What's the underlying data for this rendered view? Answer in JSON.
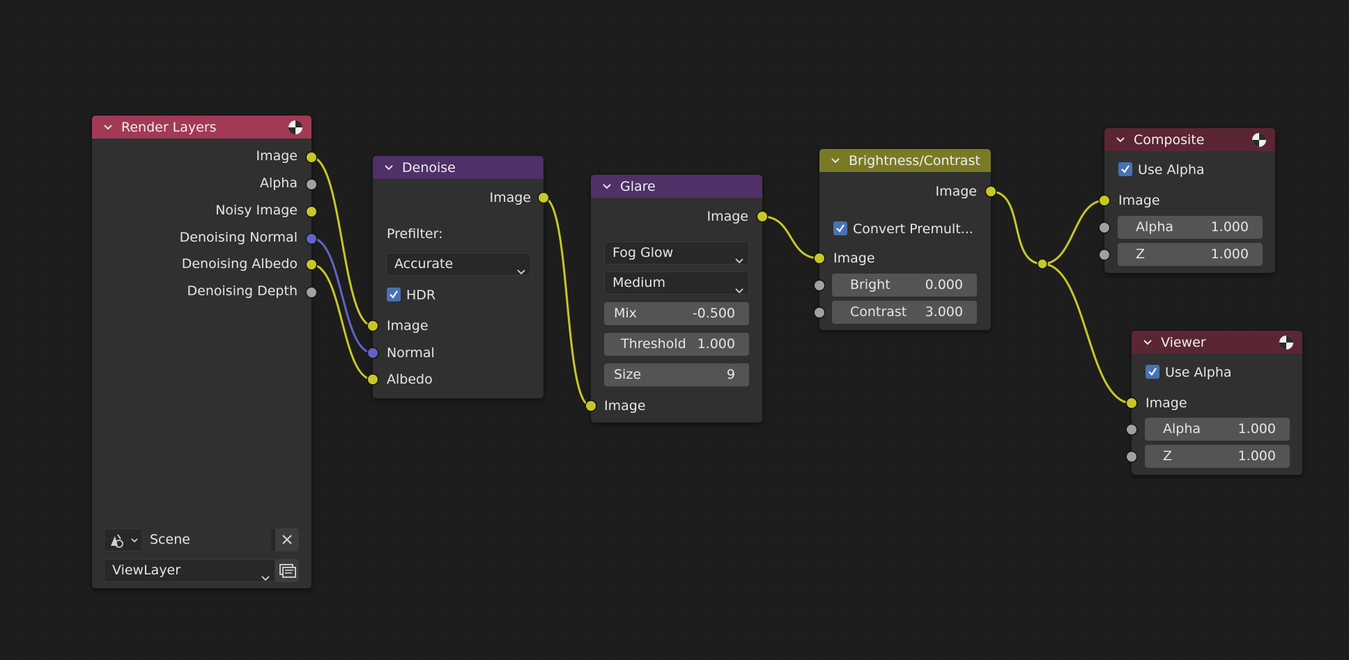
{
  "colors": {
    "background": "#1d1d1d",
    "node_body": "#303030",
    "header_input": "#a23a55",
    "header_filter": "#4f3068",
    "header_color": "#7a7a26",
    "header_output": "#5b2633",
    "socket_color": "#c7c729",
    "socket_float": "#a1a1a1",
    "socket_vector": "#6363c7",
    "checkbox": "#4772b3"
  },
  "nodes": {
    "render_layers": {
      "title": "Render Layers",
      "icon": "render-result-icon",
      "outputs": [
        "Image",
        "Alpha",
        "Noisy Image",
        "Denoising Normal",
        "Denoising Albedo",
        "Denoising Depth"
      ],
      "scene_value": "Scene",
      "scene_icon": "scene-icon",
      "clear_icon": "close-icon",
      "view_layer_value": "ViewLayer",
      "view_layer_icon": "view-layer-icon"
    },
    "denoise": {
      "title": "Denoise",
      "output": "Image",
      "prefilter_label": "Prefilter:",
      "prefilter_value": "Accurate",
      "hdr_label": "HDR",
      "hdr_checked": true,
      "inputs": [
        "Image",
        "Normal",
        "Albedo"
      ]
    },
    "glare": {
      "title": "Glare",
      "output": "Image",
      "type_value": "Fog Glow",
      "quality_value": "Medium",
      "mix_label": "Mix",
      "mix_value": "-0.500",
      "threshold_label": "Threshold",
      "threshold_value": "1.000",
      "size_label": "Size",
      "size_value": "9",
      "input": "Image"
    },
    "brightness_contrast": {
      "title": "Brightness/Contrast",
      "output": "Image",
      "convert_label": "Convert Premult...",
      "convert_checked": true,
      "input": "Image",
      "bright_label": "Bright",
      "bright_value": "0.000",
      "contrast_label": "Contrast",
      "contrast_value": "3.000"
    },
    "composite": {
      "title": "Composite",
      "icon": "render-result-icon",
      "use_alpha_label": "Use Alpha",
      "use_alpha_checked": true,
      "input": "Image",
      "alpha_label": "Alpha",
      "alpha_value": "1.000",
      "z_label": "Z",
      "z_value": "1.000"
    },
    "viewer": {
      "title": "Viewer",
      "icon": "render-result-icon",
      "use_alpha_label": "Use Alpha",
      "use_alpha_checked": true,
      "input": "Image",
      "alpha_label": "Alpha",
      "alpha_value": "1.000",
      "z_label": "Z",
      "z_value": "1.000"
    }
  },
  "links": [
    {
      "from": "Render Layers.Image",
      "to": "Denoise.Image"
    },
    {
      "from": "Render Layers.Denoising Normal",
      "to": "Denoise.Normal"
    },
    {
      "from": "Render Layers.Denoising Albedo",
      "to": "Denoise.Albedo"
    },
    {
      "from": "Denoise.Image",
      "to": "Glare.Image"
    },
    {
      "from": "Glare.Image",
      "to": "Brightness/Contrast.Image"
    },
    {
      "from": "Brightness/Contrast.Image",
      "to": "Reroute"
    },
    {
      "from": "Reroute",
      "to": "Composite.Image"
    },
    {
      "from": "Reroute",
      "to": "Viewer.Image"
    }
  ]
}
